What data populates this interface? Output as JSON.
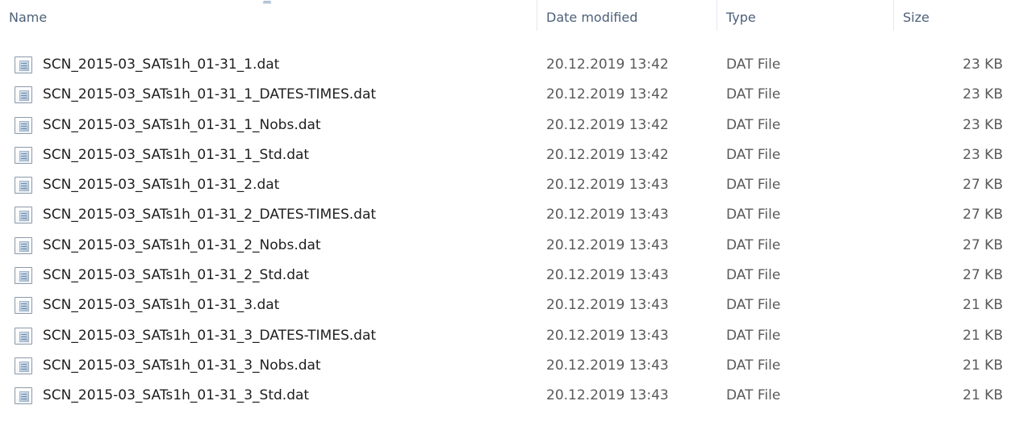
{
  "columns": {
    "name": "Name",
    "date_modified": "Date modified",
    "type": "Type",
    "size": "Size"
  },
  "sort": {
    "column": "name",
    "direction": "ascending"
  },
  "files": [
    {
      "name": "SCN_2015-03_SATs1h_01-31_1.dat",
      "date_modified": "20.12.2019 13:42",
      "type": "DAT File",
      "size": "23 KB",
      "icon": "generic-file-icon"
    },
    {
      "name": "SCN_2015-03_SATs1h_01-31_1_DATES-TIMES.dat",
      "date_modified": "20.12.2019 13:42",
      "type": "DAT File",
      "size": "23 KB",
      "icon": "generic-file-icon"
    },
    {
      "name": "SCN_2015-03_SATs1h_01-31_1_Nobs.dat",
      "date_modified": "20.12.2019 13:42",
      "type": "DAT File",
      "size": "23 KB",
      "icon": "generic-file-icon"
    },
    {
      "name": "SCN_2015-03_SATs1h_01-31_1_Std.dat",
      "date_modified": "20.12.2019 13:42",
      "type": "DAT File",
      "size": "23 KB",
      "icon": "generic-file-icon"
    },
    {
      "name": "SCN_2015-03_SATs1h_01-31_2.dat",
      "date_modified": "20.12.2019 13:43",
      "type": "DAT File",
      "size": "27 KB",
      "icon": "generic-file-icon"
    },
    {
      "name": "SCN_2015-03_SATs1h_01-31_2_DATES-TIMES.dat",
      "date_modified": "20.12.2019 13:43",
      "type": "DAT File",
      "size": "27 KB",
      "icon": "generic-file-icon"
    },
    {
      "name": "SCN_2015-03_SATs1h_01-31_2_Nobs.dat",
      "date_modified": "20.12.2019 13:43",
      "type": "DAT File",
      "size": "27 KB",
      "icon": "generic-file-icon"
    },
    {
      "name": "SCN_2015-03_SATs1h_01-31_2_Std.dat",
      "date_modified": "20.12.2019 13:43",
      "type": "DAT File",
      "size": "27 KB",
      "icon": "generic-file-icon"
    },
    {
      "name": "SCN_2015-03_SATs1h_01-31_3.dat",
      "date_modified": "20.12.2019 13:43",
      "type": "DAT File",
      "size": "21 KB",
      "icon": "generic-file-icon"
    },
    {
      "name": "SCN_2015-03_SATs1h_01-31_3_DATES-TIMES.dat",
      "date_modified": "20.12.2019 13:43",
      "type": "DAT File",
      "size": "21 KB",
      "icon": "generic-file-icon"
    },
    {
      "name": "SCN_2015-03_SATs1h_01-31_3_Nobs.dat",
      "date_modified": "20.12.2019 13:43",
      "type": "DAT File",
      "size": "21 KB",
      "icon": "generic-file-icon"
    },
    {
      "name": "SCN_2015-03_SATs1h_01-31_3_Std.dat",
      "date_modified": "20.12.2019 13:43",
      "type": "DAT File",
      "size": "21 KB",
      "icon": "generic-file-icon"
    }
  ]
}
